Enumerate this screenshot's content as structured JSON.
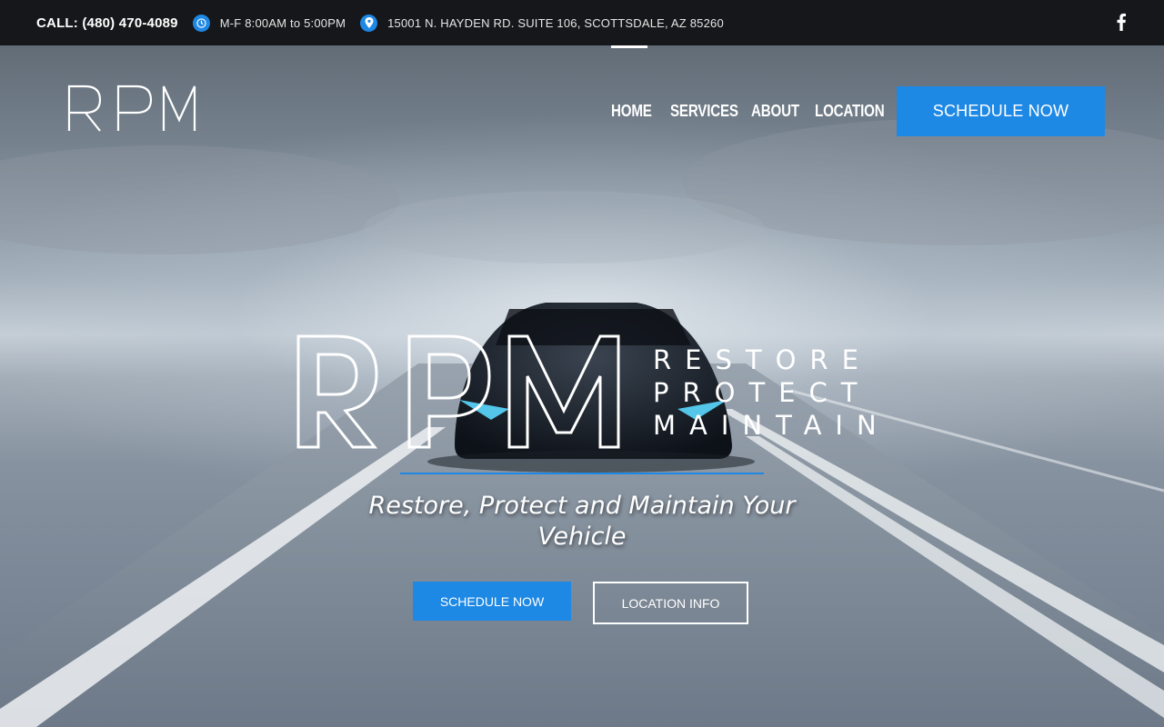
{
  "topbar": {
    "phone": "CALL: (480) 470-4089",
    "hours": "M-F 8:00AM to 5:00PM",
    "address": "15001 N. HAYDEN RD. SUITE 106, SCOTTSDALE, AZ 85260",
    "hours_icon": "clock-icon",
    "address_icon": "map-pin-icon",
    "social_icon": "facebook-icon"
  },
  "nav": {
    "logo_text": "RPM",
    "items": [
      {
        "label": "HOME",
        "active": true
      },
      {
        "label": "SERVICES",
        "active": false
      },
      {
        "label": "ABOUT",
        "active": false
      },
      {
        "label": "LOCATION",
        "active": false
      }
    ],
    "cta_label": "SCHEDULE NOW"
  },
  "hero": {
    "logo_mark": "RPM",
    "logo_words": [
      "RESTORE",
      "PROTECT",
      "MAINTAIN"
    ],
    "tagline": "Restore, Protect and Maintain Your Vehicle",
    "primary_button": "SCHEDULE NOW",
    "secondary_button": "LOCATION INFO"
  },
  "colors": {
    "accent": "#1e88e5",
    "topbar_bg": "#16171a",
    "text": "#ffffff"
  }
}
